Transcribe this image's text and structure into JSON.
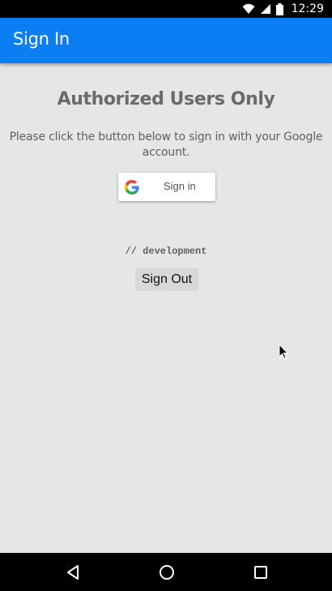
{
  "status_bar": {
    "time": "12:29",
    "icons": [
      "wifi-icon",
      "signal-icon",
      "battery-icon"
    ]
  },
  "app_bar": {
    "title": "Sign In",
    "color": "#0a7ef2"
  },
  "main": {
    "heading": "Authorized Users Only",
    "description": "Please click the button below to sign in with your Google account.",
    "google_button_label": "Sign in",
    "dev_comment": "// development",
    "signout_label": "Sign Out"
  },
  "nav_bar": {
    "icons": [
      "back-icon",
      "home-icon",
      "recents-icon"
    ]
  }
}
